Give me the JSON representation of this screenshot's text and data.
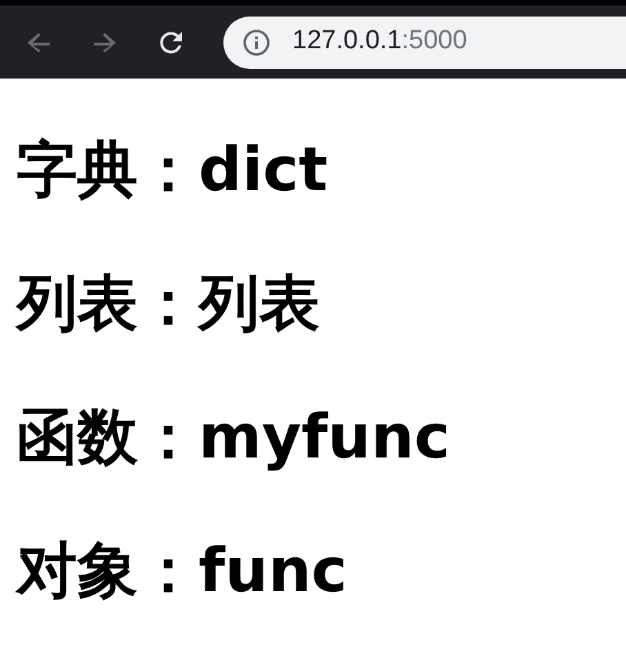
{
  "toolbar": {
    "back": {
      "disabled": true
    },
    "forward": {
      "disabled": true
    },
    "address": {
      "host": "127.0.0.1",
      "port": ":5000"
    }
  },
  "headings": [
    "字典：dict",
    "列表：列表",
    "函数：myfunc",
    "对象：func"
  ]
}
